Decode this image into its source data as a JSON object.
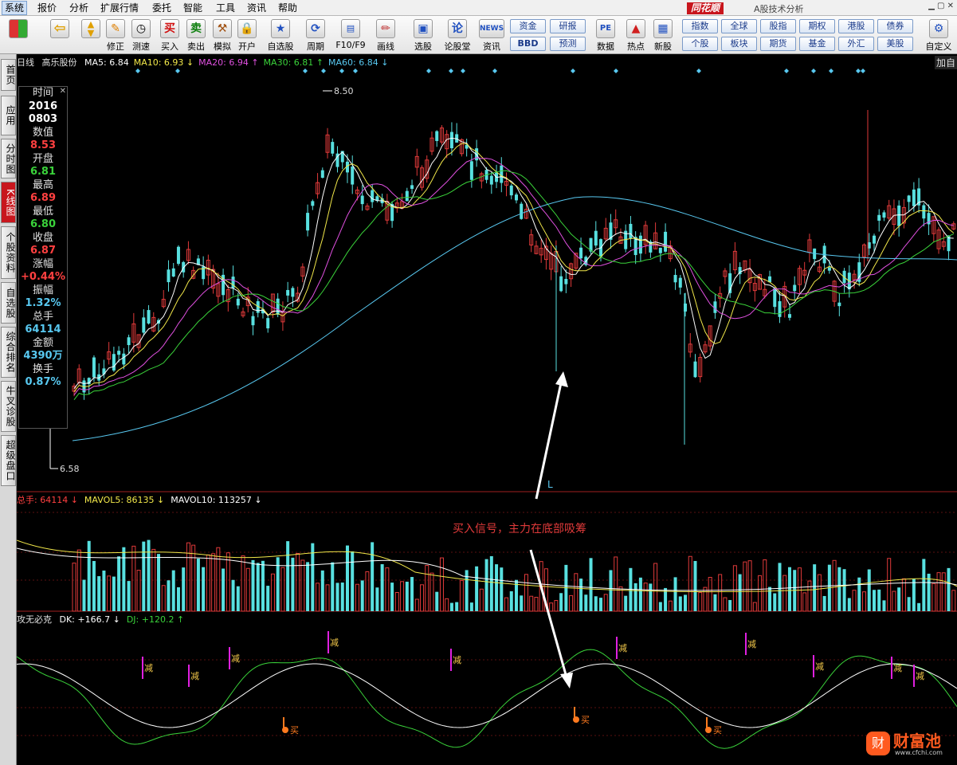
{
  "menu": [
    "系统",
    "报价",
    "分析",
    "扩展行情",
    "委托",
    "智能",
    "工具",
    "资讯",
    "帮助"
  ],
  "brand": {
    "logo": "同花顺",
    "subtitle": "A股技术分析"
  },
  "toolbar": {
    "buttons": [
      {
        "label": "",
        "icon": "grid-icon"
      },
      {
        "label": "",
        "icon": "back-arrow-icon"
      },
      {
        "label": "",
        "icon": "up-down-icon"
      },
      {
        "label": "修正",
        "icon": "pen-icon"
      },
      {
        "label": "测速",
        "icon": "clock-icon"
      },
      {
        "label": "买入",
        "icon": "buy-icon",
        "glyph": "买"
      },
      {
        "label": "卖出",
        "icon": "sell-icon",
        "glyph": "卖"
      },
      {
        "label": "模拟",
        "icon": "hammer-icon"
      },
      {
        "label": "开户",
        "icon": "lock-icon"
      },
      {
        "label": "自选股",
        "icon": "star-icon"
      },
      {
        "label": "周期",
        "icon": "cycle-icon"
      },
      {
        "label": "F10/F9",
        "icon": "f10-icon"
      },
      {
        "label": "画线",
        "icon": "pencil-icon"
      },
      {
        "label": "选股",
        "icon": "monitor-icon"
      },
      {
        "label": "论股堂",
        "icon": "chat-icon"
      },
      {
        "label": "资讯",
        "icon": "news-icon",
        "glyph": "NEWS"
      },
      {
        "label": "数据",
        "icon": "pe-icon",
        "glyph": "PE"
      },
      {
        "label": "热点",
        "icon": "hot-icon"
      },
      {
        "label": "新股",
        "icon": "newstock-icon"
      },
      {
        "label": "自定义",
        "icon": "custom-icon"
      }
    ],
    "quick_buttons": [
      "资金",
      "研报",
      "BBD",
      "预测"
    ],
    "market_buttons": [
      "指数",
      "全球",
      "股指",
      "期权",
      "港股",
      "债券",
      "个股",
      "板块",
      "期货",
      "基金",
      "外汇",
      "美股"
    ]
  },
  "sidebar_tabs": [
    {
      "label": "首页",
      "active": false
    },
    {
      "label": "应用",
      "active": false
    },
    {
      "label": "分时图",
      "active": false
    },
    {
      "label": "K线图",
      "active": true
    },
    {
      "label": "个股资料",
      "active": false
    },
    {
      "label": "自选股",
      "active": false
    },
    {
      "label": "综合排名",
      "active": false
    },
    {
      "label": "牛叉诊股",
      "active": false
    },
    {
      "label": "超级盘口",
      "active": false
    }
  ],
  "kline_header": {
    "period": "日线",
    "stock": "高乐股份",
    "ma": [
      {
        "label": "MA5: 6.84",
        "color": "#ffffff",
        "arrow": ""
      },
      {
        "label": "MA10: 6.93",
        "color": "#f2e84a",
        "arrow": "down"
      },
      {
        "label": "MA20: 6.94",
        "color": "#e050e0",
        "arrow": "up"
      },
      {
        "label": "MA30: 6.81",
        "color": "#3ad23a",
        "arrow": "up"
      },
      {
        "label": "MA60: 6.84",
        "color": "#58c8f0",
        "arrow": "down"
      }
    ],
    "add_label": "加自"
  },
  "info": [
    {
      "k": "时间",
      "v": "2016",
      "c": "#ffffff"
    },
    {
      "k": "",
      "v": "0803",
      "c": "#ffffff"
    },
    {
      "k": "数值",
      "v": "8.53",
      "c": "#ff4040"
    },
    {
      "k": "开盘",
      "v": "6.81",
      "c": "#3ad23a"
    },
    {
      "k": "最高",
      "v": "6.89",
      "c": "#ff4040"
    },
    {
      "k": "最低",
      "v": "6.80",
      "c": "#3ad23a"
    },
    {
      "k": "收盘",
      "v": "6.87",
      "c": "#ff4040"
    },
    {
      "k": "涨幅",
      "v": "+0.44%",
      "c": "#ff4040"
    },
    {
      "k": "振幅",
      "v": "1.32%",
      "c": "#58c8f0"
    },
    {
      "k": "总手",
      "v": "64114",
      "c": "#58c8f0"
    },
    {
      "k": "金额",
      "v": "4390万",
      "c": "#58c8f0"
    },
    {
      "k": "换手",
      "v": "0.87%",
      "c": "#58c8f0"
    }
  ],
  "price_marks": {
    "high": "8.50",
    "low": "6.58",
    "low_flag": "L"
  },
  "volume_header": [
    {
      "label": "总手: 64114",
      "color": "#ff4040",
      "arrow": "down"
    },
    {
      "label": "MAVOL5: 86135",
      "color": "#f2e84a",
      "arrow": "down"
    },
    {
      "label": "MAVOL10: 113257",
      "color": "#ffffff",
      "arrow": "down"
    }
  ],
  "indicator_header": {
    "name": "攻无必克",
    "items": [
      {
        "label": "DK: +166.7",
        "color": "#ffffff",
        "arrow": "down"
      },
      {
        "label": "DJ: +120.2",
        "color": "#3ad23a",
        "arrow": "up"
      }
    ]
  },
  "annotation": "买入信号，主力在底部吸筹",
  "signals": {
    "sell_label": "减",
    "buy_label": "买"
  },
  "watermark": {
    "brand": "财富池",
    "url": "www.cfchi.com"
  },
  "colors": {
    "up": "#e03a3a",
    "down": "#58e0e0",
    "ma60": "#58c8f0",
    "ma30": "#3ad23a",
    "ma20": "#e050e0",
    "ma10": "#f2e84a",
    "ma5": "#ffffff"
  }
}
